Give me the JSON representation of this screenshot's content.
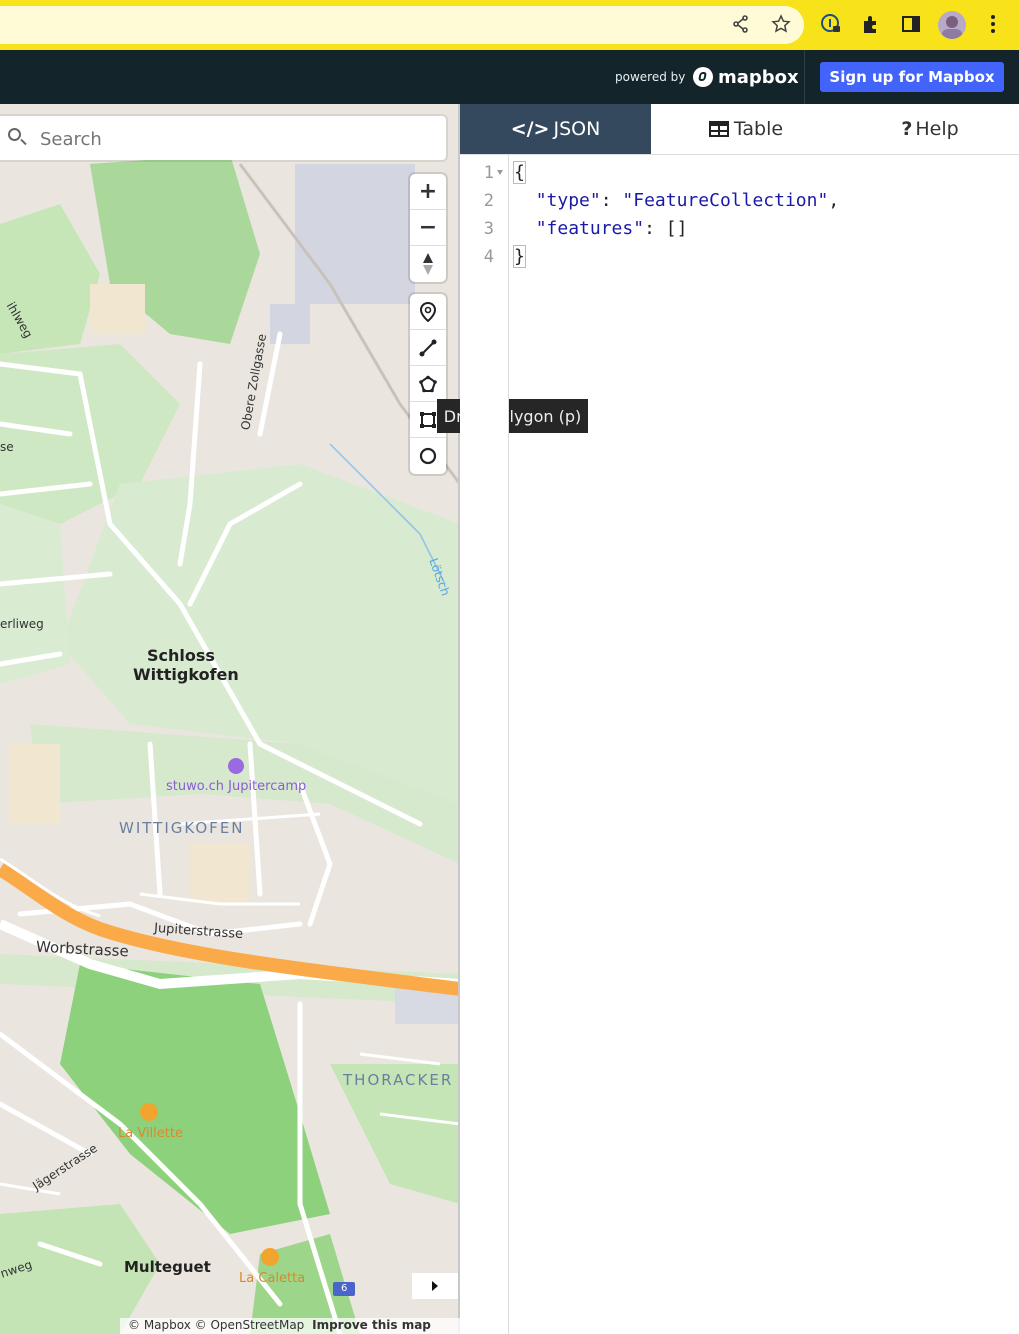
{
  "browser": {
    "icons": [
      "share-icon",
      "star-icon",
      "password-icon",
      "extensions-icon",
      "side-panel-icon",
      "avatar",
      "menu-icon"
    ]
  },
  "header": {
    "powered_by": "powered by",
    "brand": "mapbox",
    "signup_label": "Sign up for Mapbox"
  },
  "search": {
    "placeholder": "Search"
  },
  "controls": {
    "zoom_in": "+",
    "zoom_out": "−",
    "tooltip": "Draw Polygon (p)"
  },
  "map": {
    "labels": {
      "schloss": "Schloss",
      "wittigkofen_place": "Wittigkofen",
      "stuwo": "stuwo.ch Jupitercamp",
      "wittigkofen_district": "WITTIGKOFEN",
      "jupiterstrasse": "Jupiterstrasse",
      "worbstrasse": "Worbstrasse",
      "thoracker": "THORACKER",
      "la_villette": "La Villette",
      "jaegerstrasse": "Jägerstrasse",
      "multeguet": "Multeguet",
      "la_caletta": "La Caletta",
      "obere_zollgasse": "Obere Zollgasse",
      "erliweg": "erliweg",
      "loetsch": "Lötsch",
      "hlweg": "ihlweg",
      "nweg": "nweg",
      "se": "se",
      "route6": "6"
    },
    "attribution": "© Mapbox © OpenStreetMap",
    "improve": "Improve this map"
  },
  "tabs": {
    "json": "JSON",
    "table": "Table",
    "help": "Help"
  },
  "editor": {
    "line_numbers": [
      "1",
      "2",
      "3",
      "4"
    ],
    "line1": "{",
    "type_key": "\"type\"",
    "type_value": "\"FeatureCollection\"",
    "features_key": "\"features\"",
    "features_value": "[]",
    "line4": "}"
  },
  "colors": {
    "toolbar": "#f8e21a",
    "header": "#14242b",
    "signup": "#4264fb",
    "active_tab": "#34495e"
  }
}
